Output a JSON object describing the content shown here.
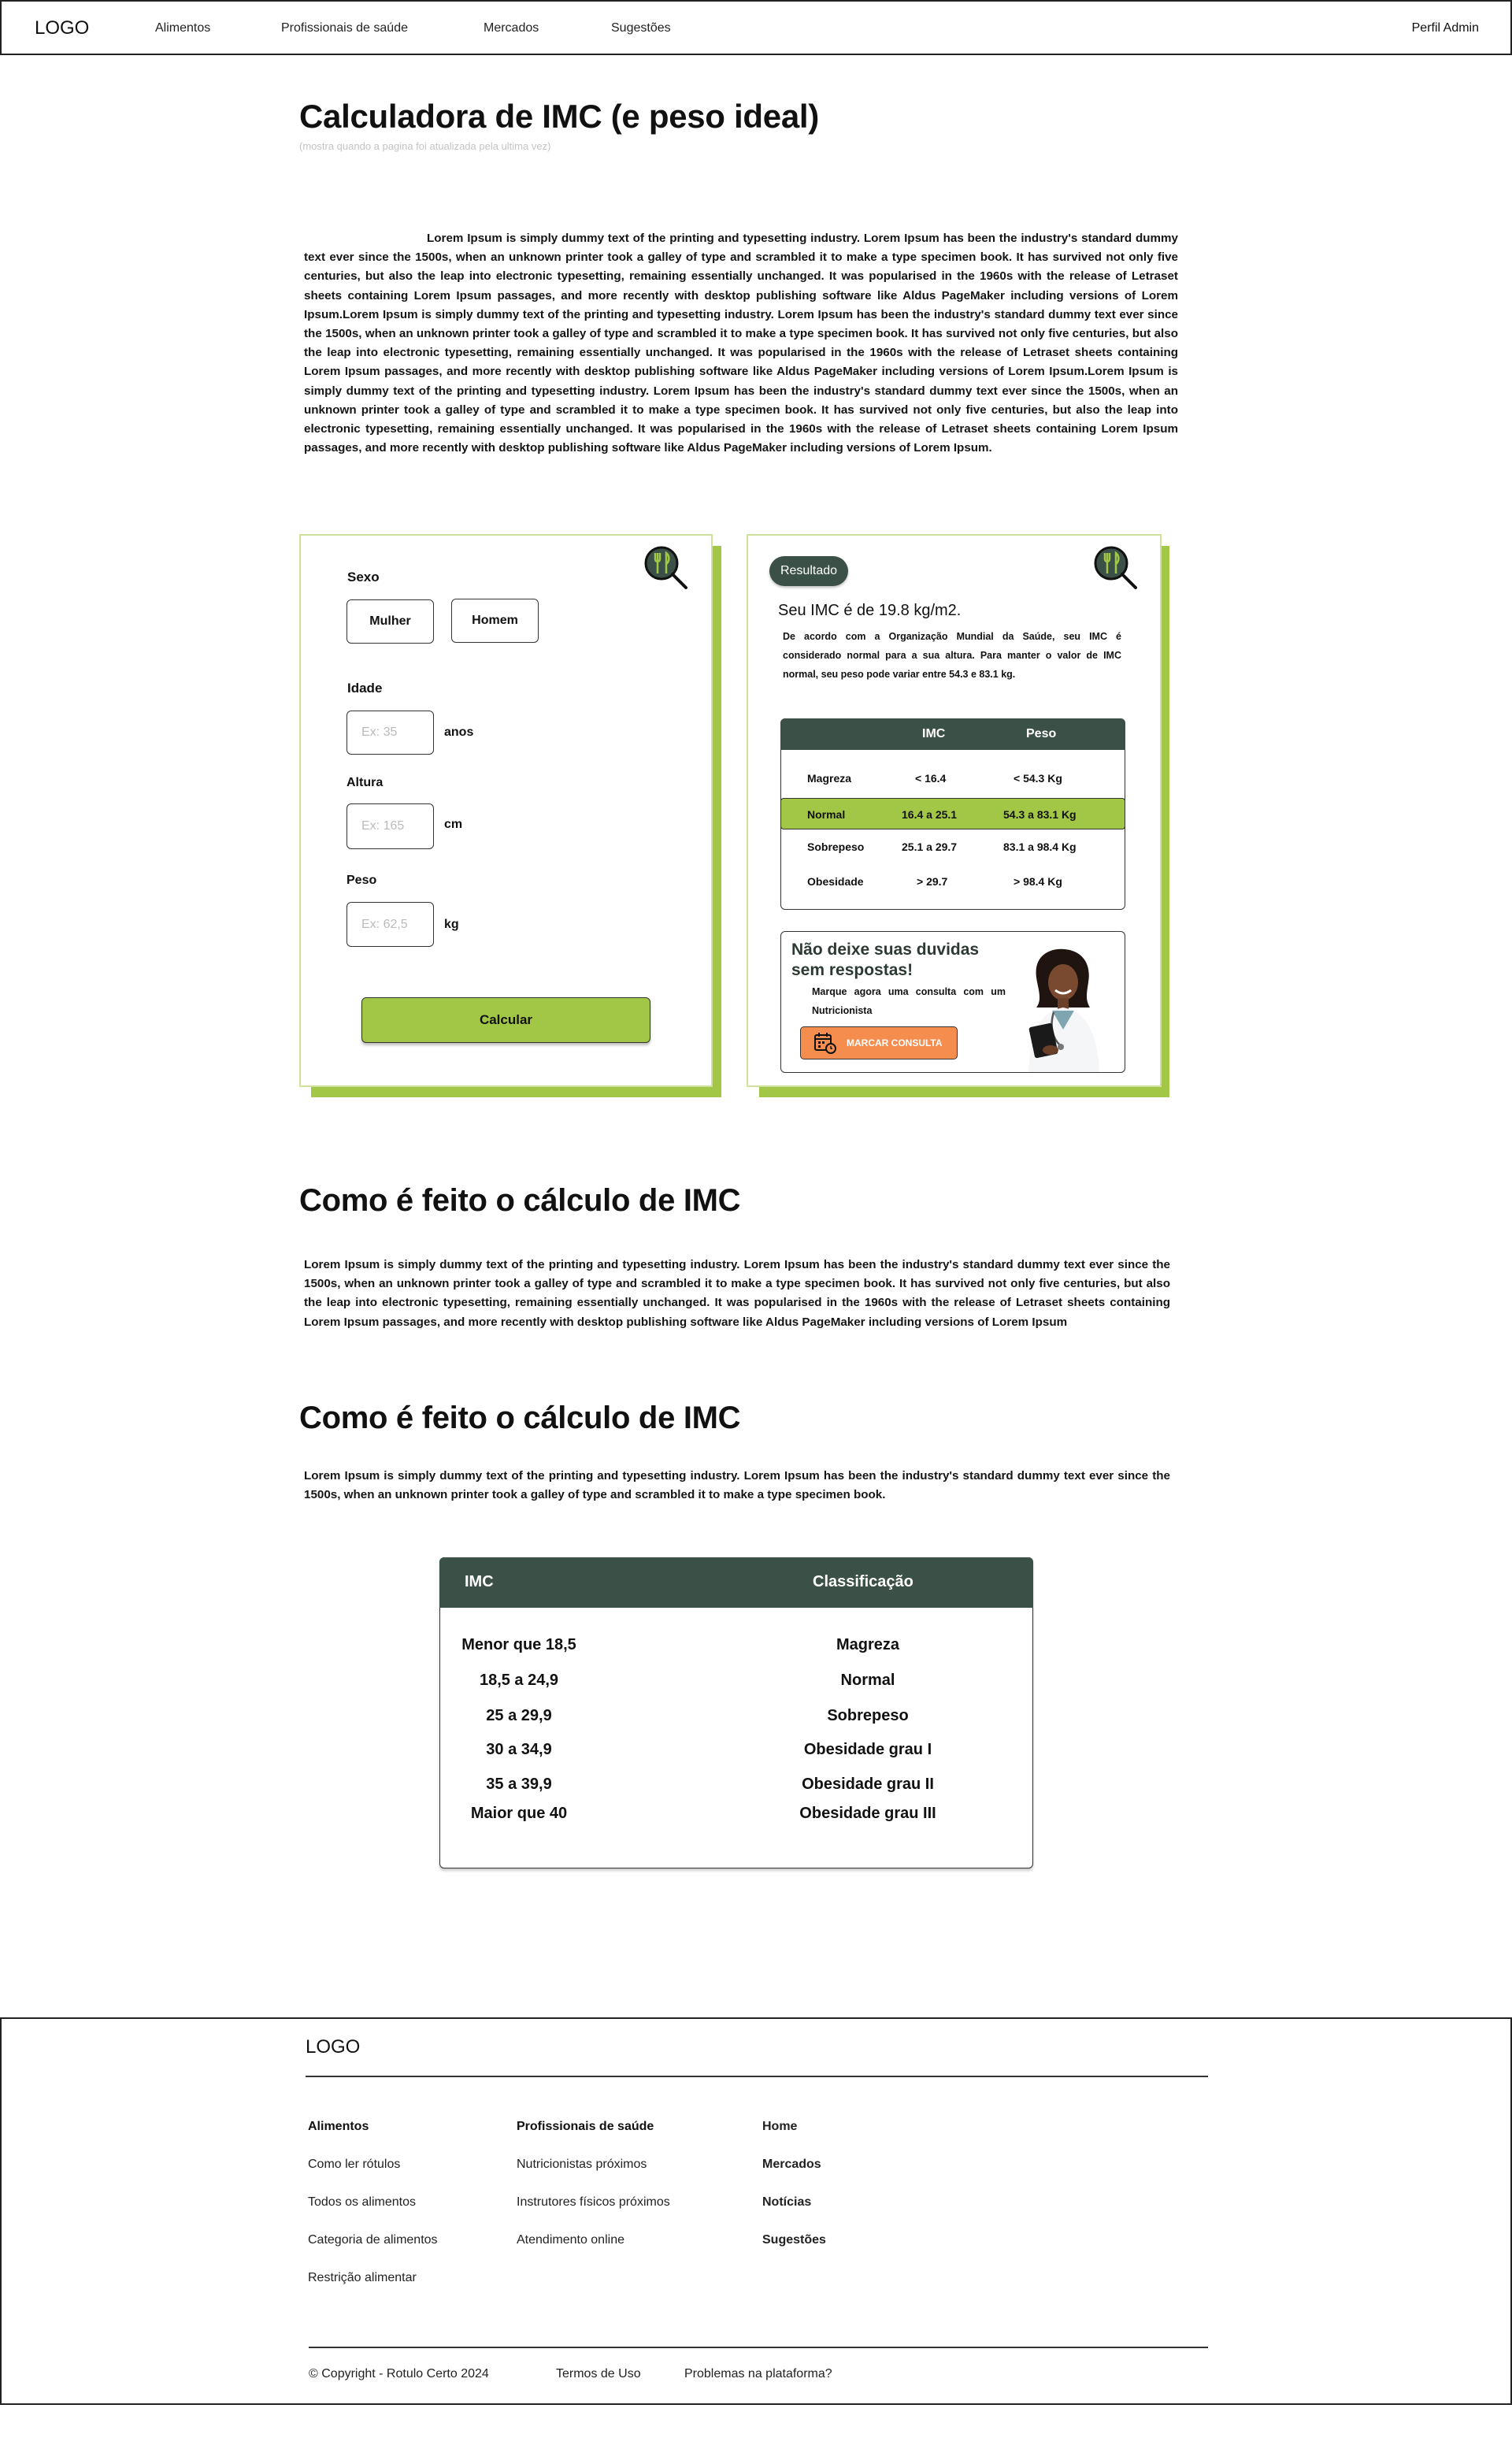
{
  "header": {
    "logo": "LOGO",
    "nav": [
      "Alimentos",
      "Profissionais de saúde",
      "Mercados",
      "Sugestões"
    ],
    "profile": "Perfil Admin"
  },
  "page": {
    "title": "Calculadora de IMC (e peso ideal)",
    "subtitle": "(mostra quando a pagina foi atualizada pela ultima vez)",
    "intro": "Lorem Ipsum is simply dummy text of the printing and typesetting industry. Lorem Ipsum has been the industry's standard dummy text ever since the 1500s, when an unknown printer took a galley of type and scrambled it to make a type specimen book. It has survived not only five centuries, but also the leap into electronic typesetting, remaining essentially unchanged. It was popularised in the 1960s with the release of Letraset sheets containing Lorem Ipsum passages, and more recently with desktop publishing software like Aldus PageMaker including versions of Lorem Ipsum.Lorem Ipsum is simply dummy text of the printing and typesetting industry. Lorem Ipsum has been the industry's standard dummy text ever since the 1500s, when an unknown printer took a galley of type and scrambled it to make a type specimen book. It has survived not only five centuries, but also the leap into electronic typesetting, remaining essentially unchanged. It was popularised in the 1960s with the release of Letraset sheets containing Lorem Ipsum passages, and more recently with desktop publishing software like Aldus PageMaker including versions of Lorem Ipsum.Lorem Ipsum is simply dummy text of the printing and typesetting industry. Lorem Ipsum has been the industry's standard dummy text ever since the 1500s, when an unknown printer took a galley of type and scrambled it to make a type specimen book. It has survived not only five centuries, but also the leap into electronic typesetting, remaining essentially unchanged. It was popularised in the 1960s with the release of Letraset sheets containing Lorem Ipsum passages, and more recently with desktop publishing software like Aldus PageMaker including versions of Lorem Ipsum."
  },
  "form": {
    "sexo_label": "Sexo",
    "mulher": "Mulher",
    "homem": "Homem",
    "idade_label": "Idade",
    "idade_placeholder": "Ex: 35",
    "idade_unit": "anos",
    "altura_label": "Altura",
    "altura_placeholder": "Ex: 165",
    "altura_unit": "cm",
    "peso_label": "Peso",
    "peso_placeholder": "Ex: 62,5",
    "peso_unit": "kg",
    "calcular": "Calcular"
  },
  "result": {
    "pill": "Resultado",
    "title": "Seu IMC é de 19.8 kg/m2.",
    "desc": "De acordo com a Organização Mundial da Saúde, seu IMC é considerado normal para a sua altura. Para manter o valor de IMC normal, seu peso pode variar entre 54.3 e 83.1 kg.",
    "table": {
      "headers": [
        "IMC",
        "Peso"
      ],
      "rows": [
        {
          "label": "Magreza",
          "imc": "< 16.4",
          "peso": "< 54.3 Kg"
        },
        {
          "label": "Normal",
          "imc": "16.4 a 25.1",
          "peso": "54.3 a 83.1 Kg"
        },
        {
          "label": "Sobrepeso",
          "imc": "25.1 a 29.7",
          "peso": "83.1 a 98.4 Kg"
        },
        {
          "label": "Obesidade",
          "imc": "> 29.7",
          "peso": "> 98.4 Kg"
        }
      ]
    },
    "cta": {
      "title": "Não deixe suas duvidas sem respostas!",
      "text": "Marque agora uma consulta com um Nutricionista",
      "button": "MARCAR CONSULTA"
    }
  },
  "section1": {
    "title": "Como é feito o cálculo de IMC",
    "text": "Lorem Ipsum is simply dummy text of the printing and typesetting industry. Lorem Ipsum has been the industry's standard dummy text ever since the 1500s, when an unknown printer took a galley of type and scrambled it to make a type specimen book. It has survived not only five centuries, but also the leap into electronic typesetting, remaining essentially unchanged. It was popularised in the 1960s with the release of Letraset sheets containing Lorem Ipsum passages, and more recently with desktop publishing software like Aldus PageMaker including versions of Lorem Ipsum"
  },
  "section2": {
    "title": "Como é feito o cálculo de IMC",
    "text": "Lorem Ipsum is simply dummy text of the printing and typesetting industry. Lorem Ipsum has been the industry's standard dummy text ever since the 1500s, when an unknown printer took a galley of type and scrambled it to make a type specimen book."
  },
  "big_table": {
    "headers": [
      "IMC",
      "Classificação"
    ],
    "rows": [
      {
        "imc": "Menor que 18,5",
        "class": "Magreza"
      },
      {
        "imc": "18,5 a 24,9",
        "class": "Normal"
      },
      {
        "imc": "25 a 29,9",
        "class": "Sobrepeso"
      },
      {
        "imc": "30 a 34,9",
        "class": "Obesidade grau I"
      },
      {
        "imc": "35 a 39,9",
        "class": "Obesidade grau II"
      },
      {
        "imc": "Maior que 40",
        "class": "Obesidade grau III"
      }
    ]
  },
  "footer": {
    "logo": "LOGO",
    "col1": [
      "Alimentos",
      "Como ler rótulos",
      "Todos os alimentos",
      "Categoria de alimentos",
      "Restrição alimentar"
    ],
    "col2": [
      "Profissionais de saúde",
      "Nutricionistas próximos",
      "Instrutores físicos próximos",
      "Atendimento online"
    ],
    "col3": [
      "Home",
      "Mercados",
      "Notícias",
      "Sugestões"
    ],
    "copyright": "© Copyright - Rotulo Certo 2024",
    "terms": "Termos de Uso",
    "problems": "Problemas na plataforma?"
  },
  "colors": {
    "accent_green": "#a2c645",
    "dark_green": "#3b5148",
    "orange": "#f58d4f"
  }
}
